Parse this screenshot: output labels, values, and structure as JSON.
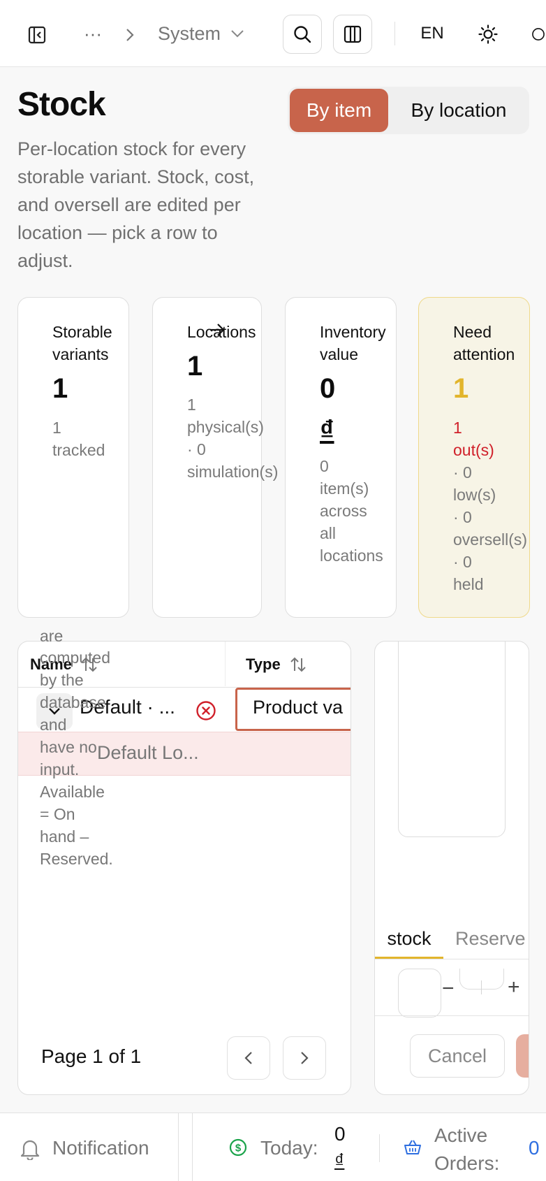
{
  "topbar": {
    "breadcrumb_more": "···",
    "breadcrumb_current": "System",
    "language": "EN"
  },
  "header": {
    "title": "Stock",
    "description": "Per-location stock for every storable variant. Stock, cost, and oversell are edited per location — pick a row to adjust.",
    "view_toggle": {
      "by_item": "By item",
      "by_location": "By location",
      "selected": "By item"
    }
  },
  "stats": [
    {
      "label": "Storable variants",
      "value": "1",
      "sub": [
        "1",
        "tracked"
      ]
    },
    {
      "label": "Locations",
      "value": "1",
      "sub": [
        "1",
        "physical(s)",
        "· 0",
        "simulation(s)"
      ]
    },
    {
      "label": "Inventory value",
      "value": "0",
      "currency": "₫",
      "sub": [
        "0",
        "item(s)",
        "across",
        "all",
        "locations"
      ]
    },
    {
      "label": "Need attention",
      "value": "1",
      "sub_alert": [
        "1",
        "out(s)"
      ],
      "sub": [
        "· 0",
        "low(s)",
        "· 0",
        "oversell(s)",
        "· 0",
        "held"
      ]
    }
  ],
  "table": {
    "columns": [
      "Name",
      "Type"
    ],
    "rows": [
      {
        "name": "Default · ...",
        "type": "Product va"
      },
      {
        "name": "Default Lo..."
      }
    ],
    "pagination": "Page 1 of 1"
  },
  "side_panel": {
    "note": [
      "are",
      "computed",
      "by the",
      "database",
      "and",
      "have no",
      "input.",
      "Available",
      "= On",
      "hand –",
      "Reserved."
    ],
    "tabs": [
      "stock",
      "Reserve"
    ],
    "cancel_label": "Cancel"
  },
  "statusbar": {
    "notification": "Notification",
    "today_label": "Today:",
    "today_value": "0",
    "today_currency": "₫",
    "active_orders_label_1": "Active",
    "active_orders_label_2": "Orders:",
    "active_orders_value": "0"
  },
  "colors": {
    "accent": "#c8644b",
    "warning": "#e2b52c",
    "danger": "#d0202a",
    "success": "#1aa34a",
    "link": "#2f6fe0"
  }
}
